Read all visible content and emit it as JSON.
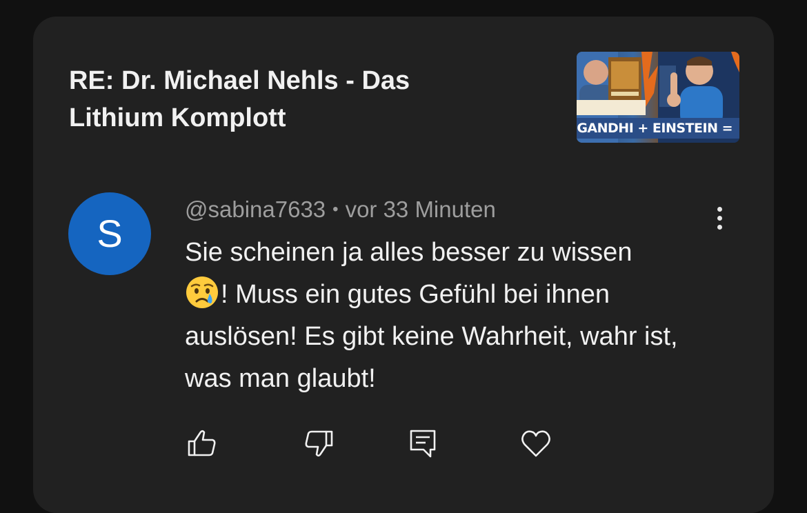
{
  "video": {
    "title": "RE: Dr. Michael Nehls - Das Lithium Komplott",
    "thumbnail_caption": "GANDHI + EINSTEIN = ?"
  },
  "comment": {
    "avatar_letter": "S",
    "author": "@sabina7633",
    "separator": "•",
    "time": "vor 33 Minuten",
    "text_before_emoji": "Sie scheinen ja alles besser zu wissen",
    "emoji": "crying-face",
    "text_after_emoji": "! Muss ein gutes Gefühl bei ihnen auslösen! Es gibt keine Wahrheit, wahr ist, was man glaubt!"
  },
  "actions": {
    "like_icon": "thumbs-up-icon",
    "dislike_icon": "thumbs-down-icon",
    "reply_icon": "reply-icon",
    "heart_icon": "heart-icon"
  },
  "colors": {
    "background": "#111111",
    "card": "#212121",
    "text_primary": "#f1f1f1",
    "text_secondary": "#9e9e9e",
    "avatar": "#1565c0"
  }
}
